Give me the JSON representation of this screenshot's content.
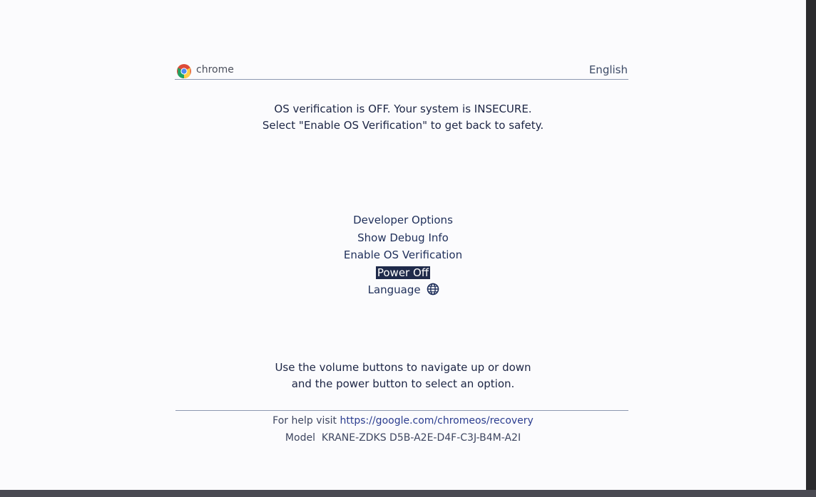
{
  "header": {
    "brand": "chrome",
    "language": "English"
  },
  "warning": {
    "line1": "OS verification is OFF. Your system is INSECURE.",
    "line2": "Select \"Enable OS Verification\" to get back to safety."
  },
  "menu": {
    "items": [
      {
        "label": "Developer Options"
      },
      {
        "label": "Show Debug Info"
      },
      {
        "label": "Enable OS Verification"
      },
      {
        "label": "Power Off",
        "selected": true
      },
      {
        "label": "Language",
        "icon": "globe-icon"
      }
    ]
  },
  "instructions": {
    "line1": "Use the volume buttons to navigate up or down",
    "line2": "and the power button to select an option."
  },
  "footer": {
    "help_prefix": "For help visit ",
    "help_url": "https://google.com/chromeos/recovery",
    "model_label": "Model",
    "model_value": "KRANE-ZDKS D5B-A2E-D4F-C3J-B4M-A2I"
  },
  "colors": {
    "background": "#fbfbfd",
    "text": "#1c2544",
    "selected_bg": "#1f2a4a",
    "link": "#2b3d8f"
  }
}
